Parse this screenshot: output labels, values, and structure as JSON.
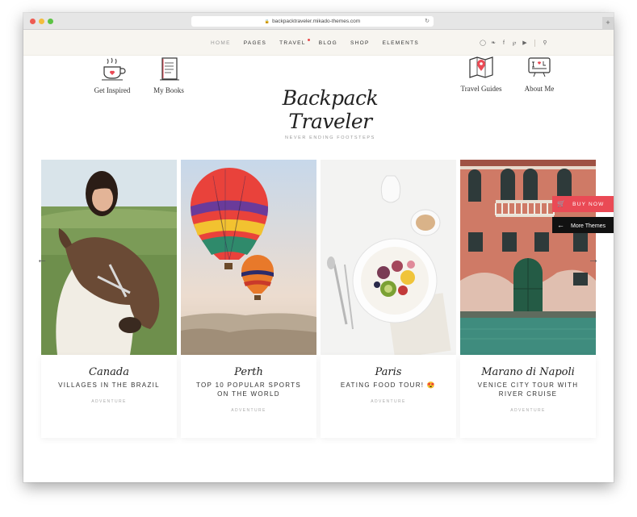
{
  "browser": {
    "url": "backpacktraveler.mikado-themes.com"
  },
  "nav": {
    "items": [
      {
        "label": "HOME"
      },
      {
        "label": "PAGES"
      },
      {
        "label": "TRAVEL"
      },
      {
        "label": "BLOG"
      },
      {
        "label": "SHOP"
      },
      {
        "label": "ELEMENTS"
      }
    ],
    "social": [
      "instagram-icon",
      "twitter-icon",
      "facebook-icon",
      "pinterest-icon",
      "youtube-icon"
    ],
    "search_icon": "search-icon"
  },
  "header": {
    "logo": "Backpack Traveler",
    "tagline": "NEVER ENDING FOOTSTEPS",
    "links": [
      {
        "label": "Get Inspired",
        "icon": "coffee-cup-icon"
      },
      {
        "label": "My Books",
        "icon": "notebook-icon"
      },
      {
        "label": "Travel Guides",
        "icon": "map-pin-icon"
      },
      {
        "label": "About Me",
        "icon": "i-love-travel-icon"
      }
    ]
  },
  "cards": [
    {
      "place": "Canada",
      "title": "VILLAGES IN THE BRAZIL",
      "category": "ADVENTURE"
    },
    {
      "place": "Perth",
      "title": "TOP 10 POPULAR SPORTS ON THE WORLD",
      "category": "ADVENTURE"
    },
    {
      "place": "Paris",
      "title": "EATING FOOD TOUR! 😍",
      "category": "ADVENTURE"
    },
    {
      "place": "Marano di Napoli",
      "title": "VENICE CITY TOUR WITH RIVER CRUISE",
      "category": "ADVENTURE"
    }
  ],
  "side_buttons": {
    "buy": "BUY NOW",
    "more": "More Themes"
  },
  "colors": {
    "accent": "#ea4a55",
    "nav_bg": "#f7f5f0"
  }
}
